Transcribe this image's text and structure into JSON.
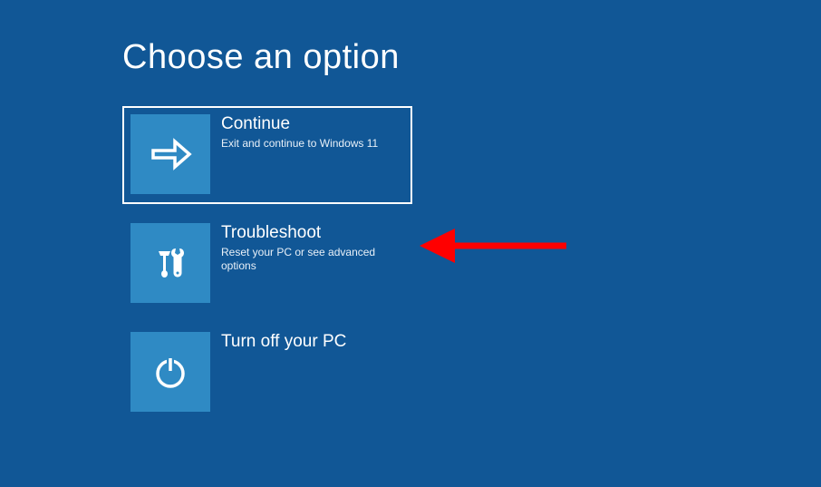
{
  "header": {
    "title": "Choose an option"
  },
  "options": {
    "continue": {
      "title": "Continue",
      "desc": "Exit and continue to Windows 11"
    },
    "troubleshoot": {
      "title": "Troubleshoot",
      "desc": "Reset your PC or see advanced options"
    },
    "turnoff": {
      "title": "Turn off your PC",
      "desc": ""
    }
  }
}
